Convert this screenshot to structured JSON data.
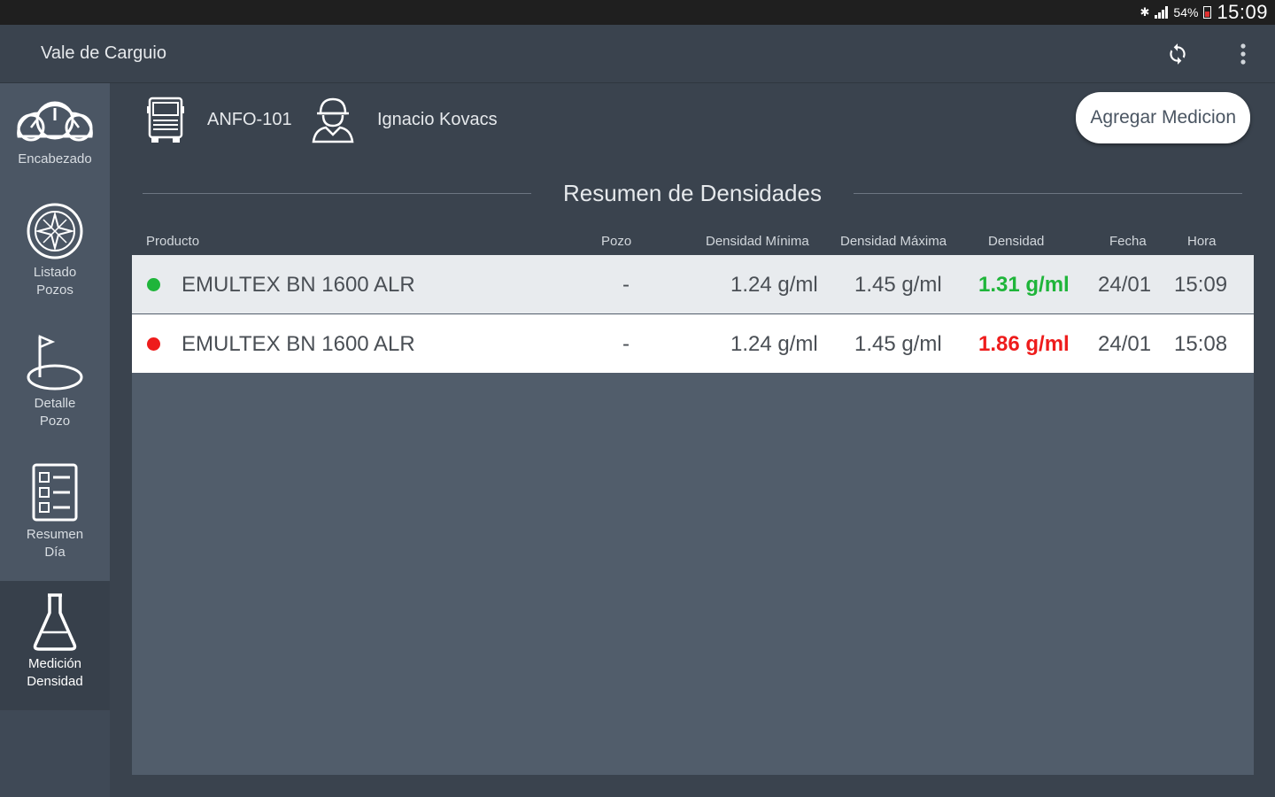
{
  "status_bar": {
    "battery": "54%",
    "time": "15:09"
  },
  "app_bar": {
    "title": "Vale de Carguio",
    "sync_icon": "sync-icon",
    "menu_icon": "more-vert-icon"
  },
  "sidebar": {
    "items": [
      {
        "label1": "Encabezado",
        "label2": "",
        "icon": "gauge-icon"
      },
      {
        "label1": "Listado",
        "label2": "Pozos",
        "icon": "compass-icon"
      },
      {
        "label1": "Detalle",
        "label2": "Pozo",
        "icon": "flag-hole-icon"
      },
      {
        "label1": "Resumen",
        "label2": "Día",
        "icon": "checklist-icon"
      },
      {
        "label1": "Medición",
        "label2": "Densidad",
        "icon": "flask-icon"
      }
    ]
  },
  "info": {
    "truck": "ANFO-101",
    "operator": "Ignacio Kovacs",
    "add_button": "Agregar Medicion"
  },
  "section_title": "Resumen de Densidades",
  "table": {
    "headers": [
      "Producto",
      "Pozo",
      "Densidad Mínima",
      "Densidad Máxima",
      "Densidad",
      "Fecha",
      "Hora"
    ],
    "rows": [
      {
        "status_color": "#1fb53a",
        "producto": "EMULTEX BN 1600 ALR",
        "pozo": "-",
        "min": "1.24 g/ml",
        "max": "1.45 g/ml",
        "densidad": "1.31 g/ml",
        "densidad_color": "#1fb53a",
        "fecha": "24/01",
        "hora": "15:09"
      },
      {
        "status_color": "#ee1c1c",
        "producto": "EMULTEX BN 1600 ALR",
        "pozo": "-",
        "min": "1.24 g/ml",
        "max": "1.45 g/ml",
        "densidad": "1.86 g/ml",
        "densidad_color": "#ee1c1c",
        "fecha": "24/01",
        "hora": "15:08"
      }
    ]
  }
}
